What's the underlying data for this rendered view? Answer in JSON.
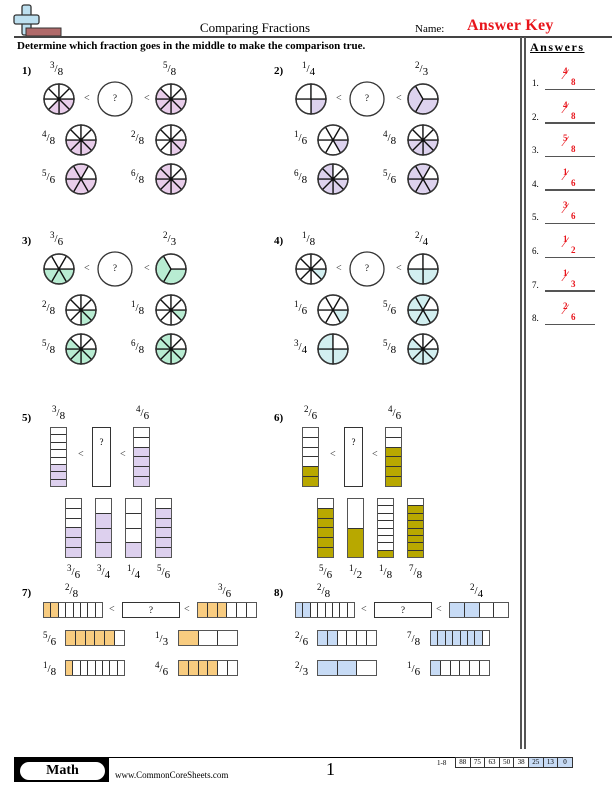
{
  "header": {
    "title": "Comparing Fractions",
    "name_label": "Name:",
    "name_value": "Answer Key",
    "logo_icon": "plus-and-minus-logo"
  },
  "instructions": "Determine which fraction goes in the middle to make the comparison true.",
  "answers": {
    "title": "Answers",
    "items": [
      {
        "label": "1.",
        "num": "4",
        "den": "8"
      },
      {
        "label": "2.",
        "num": "4",
        "den": "8"
      },
      {
        "label": "3.",
        "num": "5",
        "den": "8"
      },
      {
        "label": "4.",
        "num": "1",
        "den": "6"
      },
      {
        "label": "5.",
        "num": "3",
        "den": "6"
      },
      {
        "label": "6.",
        "num": "1",
        "den": "2"
      },
      {
        "label": "7.",
        "num": "1",
        "den": "3"
      },
      {
        "label": "8.",
        "num": "2",
        "den": "6"
      }
    ]
  },
  "colors": {
    "q1": "#e8cdea",
    "q2": "#ddd2ee",
    "q3": "#b8ecd2",
    "q4": "#d2eff0",
    "q5": "#ddd0ee",
    "q6": "#b8a800",
    "q7": "#f8cc80",
    "q8": "#c7dbf5",
    "answer_red": "#e8141b"
  },
  "problems": [
    {
      "label": "1)",
      "type": "circle",
      "left": {
        "n": 3,
        "d": 8
      },
      "right": {
        "n": 5,
        "d": 8
      },
      "question_mark": "?",
      "less_than": "<",
      "choices": [
        {
          "n": 4,
          "d": 8
        },
        {
          "n": 2,
          "d": 8
        },
        {
          "n": 5,
          "d": 6
        },
        {
          "n": 6,
          "d": 8
        }
      ]
    },
    {
      "label": "2)",
      "type": "circle",
      "left": {
        "n": 1,
        "d": 4
      },
      "right": {
        "n": 2,
        "d": 3
      },
      "question_mark": "?",
      "less_than": "<",
      "choices": [
        {
          "n": 1,
          "d": 6
        },
        {
          "n": 4,
          "d": 8
        },
        {
          "n": 6,
          "d": 8
        },
        {
          "n": 5,
          "d": 6
        }
      ]
    },
    {
      "label": "3)",
      "type": "circle",
      "left": {
        "n": 3,
        "d": 6
      },
      "right": {
        "n": 2,
        "d": 3
      },
      "question_mark": "?",
      "less_than": "<",
      "choices": [
        {
          "n": 2,
          "d": 8
        },
        {
          "n": 1,
          "d": 8
        },
        {
          "n": 5,
          "d": 8
        },
        {
          "n": 6,
          "d": 8
        }
      ]
    },
    {
      "label": "4)",
      "type": "circle",
      "left": {
        "n": 1,
        "d": 8
      },
      "right": {
        "n": 2,
        "d": 4
      },
      "question_mark": "?",
      "less_than": "<",
      "choices": [
        {
          "n": 1,
          "d": 6
        },
        {
          "n": 5,
          "d": 6
        },
        {
          "n": 3,
          "d": 4
        },
        {
          "n": 5,
          "d": 8
        }
      ]
    },
    {
      "label": "5)",
      "type": "vbar",
      "left": {
        "n": 3,
        "d": 8
      },
      "right": {
        "n": 4,
        "d": 6
      },
      "question_mark": "?",
      "less_than": "<",
      "choices": [
        {
          "n": 3,
          "d": 6
        },
        {
          "n": 3,
          "d": 4
        },
        {
          "n": 1,
          "d": 4
        },
        {
          "n": 5,
          "d": 6
        }
      ]
    },
    {
      "label": "6)",
      "type": "vbar",
      "left": {
        "n": 2,
        "d": 6
      },
      "right": {
        "n": 4,
        "d": 6
      },
      "question_mark": "?",
      "less_than": "<",
      "choices": [
        {
          "n": 5,
          "d": 6
        },
        {
          "n": 1,
          "d": 2
        },
        {
          "n": 1,
          "d": 8
        },
        {
          "n": 7,
          "d": 8
        }
      ]
    },
    {
      "label": "7)",
      "type": "hbar",
      "left": {
        "n": 2,
        "d": 8
      },
      "right": {
        "n": 3,
        "d": 6
      },
      "question_mark": "?",
      "less_than": "<",
      "choices": [
        {
          "n": 5,
          "d": 6
        },
        {
          "n": 1,
          "d": 3
        },
        {
          "n": 1,
          "d": 8
        },
        {
          "n": 4,
          "d": 6
        }
      ]
    },
    {
      "label": "8)",
      "type": "hbar",
      "left": {
        "n": 2,
        "d": 8
      },
      "right": {
        "n": 2,
        "d": 4
      },
      "question_mark": "?",
      "less_than": "<",
      "choices": [
        {
          "n": 2,
          "d": 6
        },
        {
          "n": 7,
          "d": 8
        },
        {
          "n": 2,
          "d": 3
        },
        {
          "n": 1,
          "d": 6
        }
      ]
    }
  ],
  "footer": {
    "subject": "Math",
    "url": "www.CommonCoreSheets.com",
    "page": "1",
    "score_label": "1-8",
    "scores": [
      "88",
      "75",
      "63",
      "50",
      "38",
      "25",
      "13",
      "0"
    ],
    "highlighted_scores": [
      "25",
      "13",
      "0"
    ]
  }
}
